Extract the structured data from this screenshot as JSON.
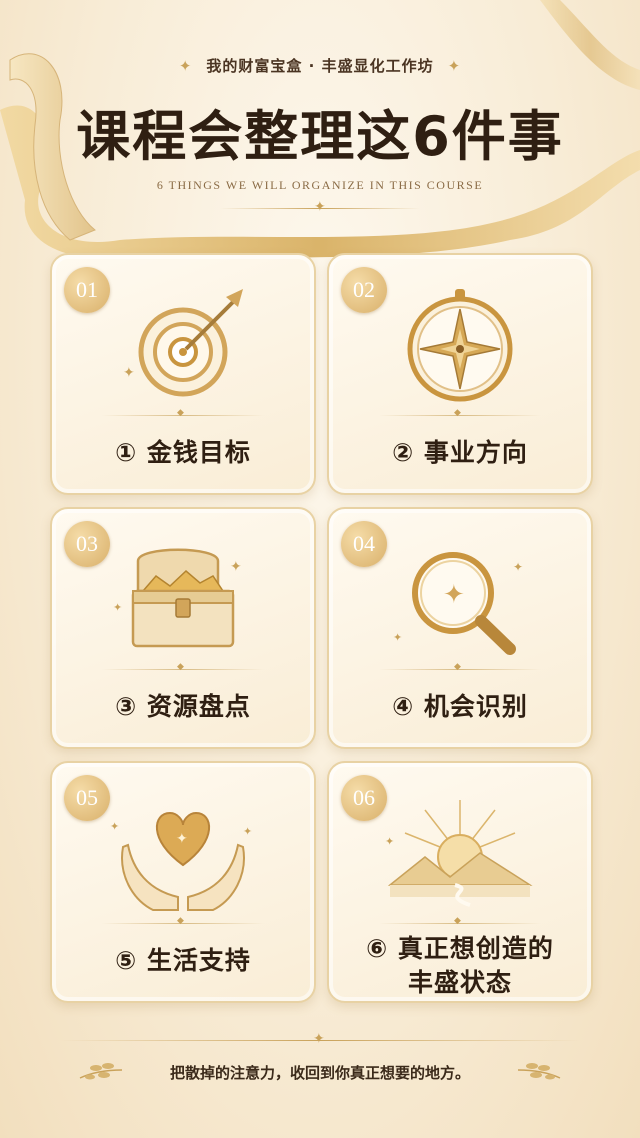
{
  "header": {
    "subtitle": "我的财富宝盒 · 丰盛显化工作坊",
    "title": "课程会整理这6件事",
    "subtitle_en": "6 THINGS WE WILL ORGANIZE IN THIS COURSE"
  },
  "cards": [
    {
      "number": "01",
      "label": "① 金钱目标",
      "icon": "target-icon"
    },
    {
      "number": "02",
      "label": "② 事业方向",
      "icon": "compass-icon"
    },
    {
      "number": "03",
      "label": "③ 资源盘点",
      "icon": "treasure-chest-icon"
    },
    {
      "number": "04",
      "label": "④ 机会识别",
      "icon": "magnifier-icon"
    },
    {
      "number": "05",
      "label": "⑤ 生活支持",
      "icon": "heart-hands-icon"
    },
    {
      "number": "06",
      "label_line1": "⑥ 真正想创造的",
      "label_line2": "丰盛状态",
      "icon": "sunrise-icon"
    }
  ],
  "footer": {
    "text": "把散掉的注意力，收回到你真正想要的地方。"
  },
  "colors": {
    "gold": "#c9a25a",
    "dark_text": "#2f1f12",
    "card_border": "#e8d2a4"
  }
}
